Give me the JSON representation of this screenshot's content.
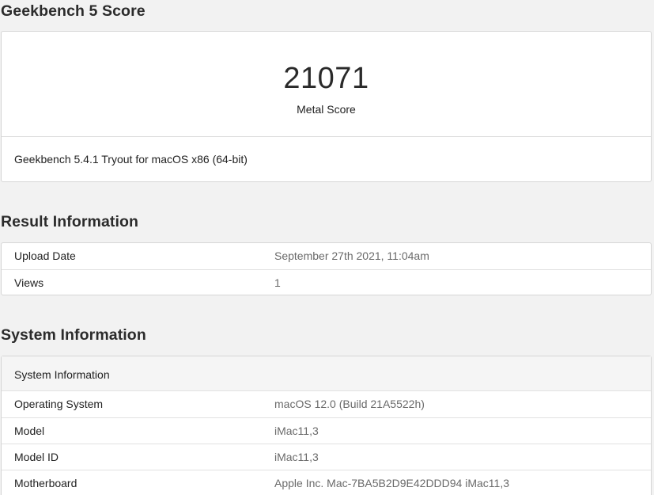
{
  "score_section": {
    "title": "Geekbench 5 Score",
    "score": "21071",
    "score_label": "Metal Score",
    "version": "Geekbench 5.4.1 Tryout for macOS x86 (64-bit)"
  },
  "result_section": {
    "title": "Result Information",
    "rows": [
      {
        "label": "Upload Date",
        "value": "September 27th 2021, 11:04am"
      },
      {
        "label": "Views",
        "value": "1"
      }
    ]
  },
  "system_section": {
    "title": "System Information",
    "header": "System Information",
    "rows": [
      {
        "label": "Operating System",
        "value": "macOS 12.0 (Build 21A5522h)"
      },
      {
        "label": "Model",
        "value": "iMac11,3"
      },
      {
        "label": "Model ID",
        "value": "iMac11,3"
      },
      {
        "label": "Motherboard",
        "value": "Apple Inc. Mac-7BA5B2D9E42DDD94 iMac11,3"
      }
    ]
  }
}
